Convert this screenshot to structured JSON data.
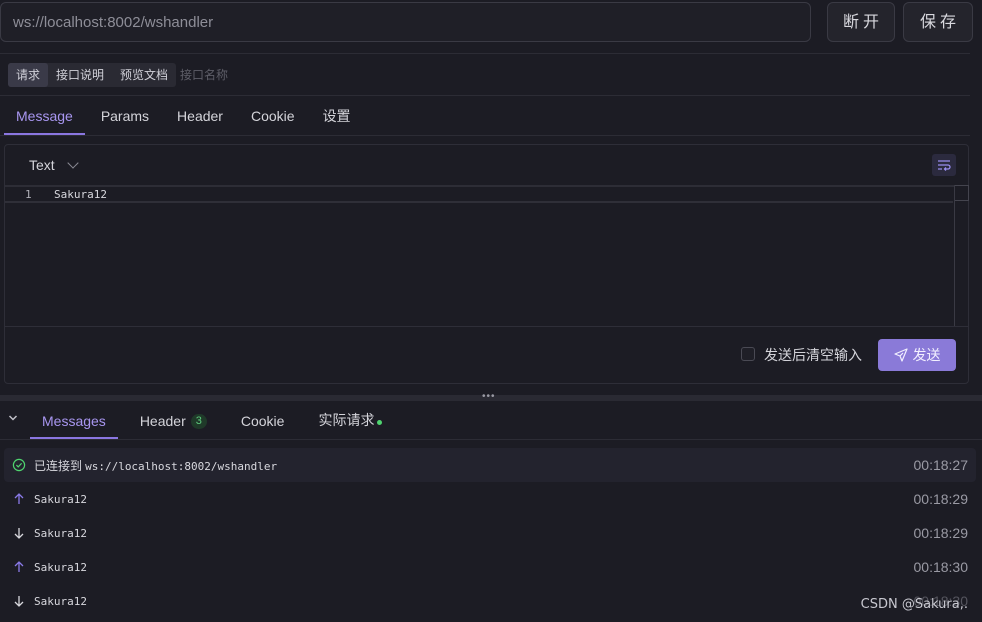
{
  "url_bar": {
    "url": "ws://localhost:8002/wshandler",
    "disconnect_label": "断开",
    "save_label": "保存"
  },
  "request_tabs": [
    "请求",
    "接口说明",
    "预览文档"
  ],
  "request_name_placeholder": "接口名称",
  "main_tabs": [
    "Message",
    "Params",
    "Header",
    "Cookie",
    "设置"
  ],
  "editor": {
    "format": "Text",
    "line_number": "1",
    "content": "Sakura12",
    "clear_after_send_label": "发送后清空输入",
    "send_label": "发送"
  },
  "response_tabs": {
    "messages": "Messages",
    "header": "Header",
    "header_count": "3",
    "cookie": "Cookie",
    "actual_request": "实际请求"
  },
  "messages": [
    {
      "type": "connected",
      "prefix": "已连接到",
      "text": "ws://localhost:8002/wshandler",
      "time": "00:18:27"
    },
    {
      "type": "sent",
      "text": "Sakura12",
      "time": "00:18:29"
    },
    {
      "type": "received",
      "text": "Sakura12",
      "time": "00:18:29"
    },
    {
      "type": "sent",
      "text": "Sakura12",
      "time": "00:18:30"
    },
    {
      "type": "received",
      "text": "Sakura12",
      "time": "00:18:30"
    }
  ],
  "watermark": "CSDN @Sakura,.",
  "colors": {
    "accent": "#8a76e0",
    "send_button": "#8a7ad8",
    "success": "#4fd46f",
    "background": "#1c1c24"
  }
}
